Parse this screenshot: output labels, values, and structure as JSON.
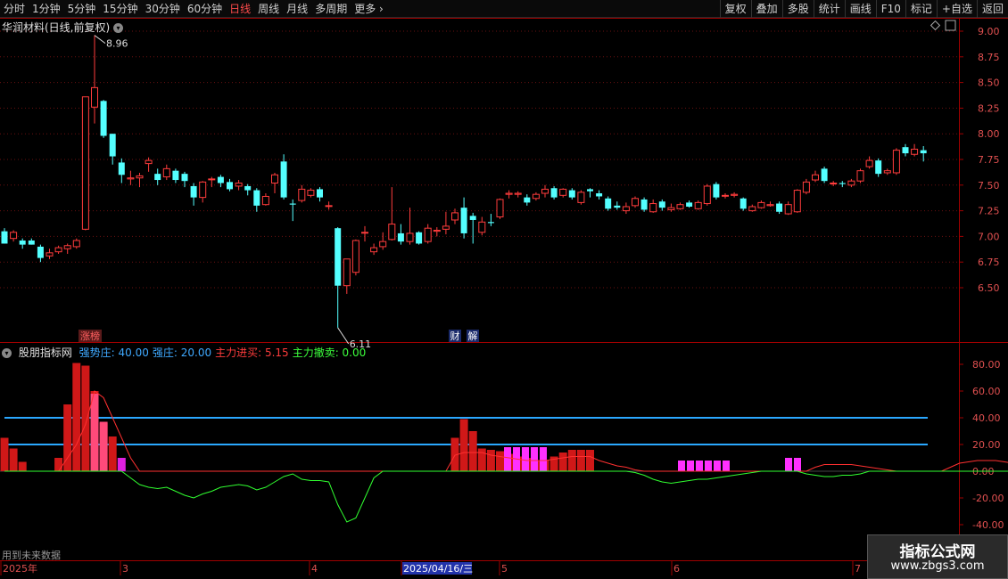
{
  "toolbar": {
    "periods": [
      "分时",
      "1分钟",
      "5分钟",
      "15分钟",
      "30分钟",
      "60分钟",
      "日线",
      "周线",
      "月线",
      "多周期",
      "更多"
    ],
    "active_period": "日线",
    "tools": [
      "复权",
      "叠加",
      "多股",
      "统计",
      "画线",
      "F10",
      "标记",
      "+自选",
      "返回"
    ]
  },
  "main_chart": {
    "title": "华润材料(日线,前复权)",
    "price_axis_ticks": [
      "9.00",
      "8.75",
      "8.50",
      "8.25",
      "8.00",
      "7.75",
      "7.50",
      "7.25",
      "7.00",
      "6.75",
      "6.50"
    ],
    "high_marker": "8.96",
    "low_marker": "6.11",
    "event_tags": [
      "涨榜",
      "财",
      "解"
    ],
    "colors": {
      "up": "#ff3c3c",
      "down": "#54ffff",
      "grid": "#7a1a1a",
      "axis": "#a00000"
    }
  },
  "indicator": {
    "name": "股朋指标网",
    "params": [
      {
        "label": "强势庄:",
        "value": "40.00",
        "color": "#3fa9ff"
      },
      {
        "label": "强庄:",
        "value": "20.00",
        "color": "#3fa9ff"
      },
      {
        "label": "主力进买:",
        "value": "5.15",
        "color": "#ff3c3c"
      },
      {
        "label": "主力撤卖:",
        "value": "0.00",
        "color": "#3cff3c"
      }
    ],
    "axis_ticks": [
      "80.00",
      "60.00",
      "40.00",
      "20.00",
      "0.00",
      "-20.00",
      "-40.00"
    ],
    "future_note": "用到未来数据"
  },
  "time_axis": {
    "labels": [
      "2025年",
      "3",
      "4",
      "2025/04/16/三",
      "5",
      "6",
      "7"
    ]
  },
  "watermark": {
    "title": "指标公式网",
    "url": "www.zbgs3.com"
  },
  "chart_data": {
    "type": "candlestick",
    "candles": [
      [
        7.05,
        6.93,
        7.08,
        6.93
      ],
      [
        6.98,
        7.04,
        7.06,
        6.95
      ],
      [
        6.96,
        6.92,
        6.98,
        6.88
      ],
      [
        6.96,
        6.92,
        6.98,
        6.92
      ],
      [
        6.9,
        6.79,
        6.92,
        6.75
      ],
      [
        6.81,
        6.84,
        6.88,
        6.78
      ],
      [
        6.85,
        6.89,
        6.91,
        6.83
      ],
      [
        6.88,
        6.91,
        6.93,
        6.83
      ],
      [
        6.9,
        6.96,
        6.98,
        6.88
      ],
      [
        7.07,
        8.36,
        8.36,
        7.06
      ],
      [
        8.26,
        8.45,
        8.96,
        8.1
      ],
      [
        8.32,
        7.98,
        8.33,
        7.96
      ],
      [
        8.0,
        7.78,
        8.0,
        7.7
      ],
      [
        7.72,
        7.6,
        7.76,
        7.52
      ],
      [
        7.56,
        7.57,
        7.64,
        7.5
      ],
      [
        7.57,
        7.59,
        7.62,
        7.48
      ],
      [
        7.71,
        7.74,
        7.77,
        7.63
      ],
      [
        7.61,
        7.55,
        7.66,
        7.5
      ],
      [
        7.58,
        7.66,
        7.7,
        7.55
      ],
      [
        7.64,
        7.55,
        7.66,
        7.52
      ],
      [
        7.61,
        7.54,
        7.63,
        7.48
      ],
      [
        7.49,
        7.38,
        7.52,
        7.3
      ],
      [
        7.38,
        7.53,
        7.54,
        7.33
      ],
      [
        7.56,
        7.56,
        7.58,
        7.48
      ],
      [
        7.58,
        7.52,
        7.6,
        7.48
      ],
      [
        7.53,
        7.46,
        7.56,
        7.44
      ],
      [
        7.49,
        7.52,
        7.55,
        7.45
      ],
      [
        7.49,
        7.45,
        7.51,
        7.4
      ],
      [
        7.45,
        7.3,
        7.47,
        7.24
      ],
      [
        7.31,
        7.39,
        7.42,
        7.3
      ],
      [
        7.52,
        7.6,
        7.62,
        7.42
      ],
      [
        7.73,
        7.38,
        7.8,
        7.36
      ],
      [
        7.32,
        7.31,
        7.36,
        7.15
      ],
      [
        7.35,
        7.46,
        7.5,
        7.33
      ],
      [
        7.4,
        7.45,
        7.47,
        7.38
      ],
      [
        7.46,
        7.38,
        7.48,
        7.34
      ],
      [
        7.3,
        7.3,
        7.34,
        7.26
      ],
      [
        7.08,
        6.52,
        7.09,
        6.11
      ],
      [
        6.52,
        6.78,
        6.78,
        6.44
      ],
      [
        6.65,
        6.96,
        6.97,
        6.62
      ],
      [
        7.04,
        7.04,
        7.1,
        6.95
      ],
      [
        6.85,
        6.89,
        6.93,
        6.82
      ],
      [
        6.9,
        6.95,
        7.04,
        6.87
      ],
      [
        6.97,
        7.12,
        7.48,
        6.96
      ],
      [
        7.03,
        6.95,
        7.12,
        6.92
      ],
      [
        6.95,
        7.03,
        7.28,
        6.92
      ],
      [
        7.04,
        6.93,
        7.05,
        6.92
      ],
      [
        6.95,
        7.08,
        7.12,
        6.93
      ],
      [
        7.05,
        7.06,
        7.09,
        7.0
      ],
      [
        7.07,
        7.1,
        7.24,
        7.02
      ],
      [
        7.16,
        7.23,
        7.27,
        7.12
      ],
      [
        7.28,
        7.03,
        7.38,
        6.98
      ],
      [
        7.2,
        7.16,
        7.23,
        6.93
      ],
      [
        7.04,
        7.14,
        7.19,
        7.01
      ],
      [
        7.14,
        7.13,
        7.22,
        7.1
      ],
      [
        7.19,
        7.36,
        7.37,
        7.17
      ],
      [
        7.41,
        7.42,
        7.45,
        7.37
      ],
      [
        7.41,
        7.42,
        7.44,
        7.38
      ],
      [
        7.38,
        7.33,
        7.41,
        7.3
      ],
      [
        7.37,
        7.41,
        7.43,
        7.35
      ],
      [
        7.42,
        7.46,
        7.5,
        7.38
      ],
      [
        7.47,
        7.38,
        7.49,
        7.36
      ],
      [
        7.4,
        7.46,
        7.47,
        7.38
      ],
      [
        7.45,
        7.38,
        7.47,
        7.36
      ],
      [
        7.33,
        7.43,
        7.45,
        7.31
      ],
      [
        7.46,
        7.44,
        7.47,
        7.38
      ],
      [
        7.42,
        7.39,
        7.45,
        7.36
      ],
      [
        7.37,
        7.27,
        7.39,
        7.25
      ],
      [
        7.3,
        7.28,
        7.34,
        7.26
      ],
      [
        7.25,
        7.29,
        7.33,
        7.22
      ],
      [
        7.3,
        7.37,
        7.39,
        7.28
      ],
      [
        7.36,
        7.26,
        7.38,
        7.24
      ],
      [
        7.24,
        7.32,
        7.36,
        7.23
      ],
      [
        7.34,
        7.28,
        7.36,
        7.25
      ],
      [
        7.26,
        7.28,
        7.32,
        7.24
      ],
      [
        7.27,
        7.31,
        7.33,
        7.26
      ],
      [
        7.33,
        7.29,
        7.35,
        7.28
      ],
      [
        7.27,
        7.33,
        7.35,
        7.26
      ],
      [
        7.32,
        7.49,
        7.51,
        7.3
      ],
      [
        7.51,
        7.38,
        7.53,
        7.36
      ],
      [
        7.4,
        7.4,
        7.42,
        7.37
      ],
      [
        7.4,
        7.41,
        7.43,
        7.38
      ],
      [
        7.37,
        7.27,
        7.38,
        7.25
      ],
      [
        7.25,
        7.29,
        7.31,
        7.24
      ],
      [
        7.28,
        7.33,
        7.35,
        7.27
      ],
      [
        7.3,
        7.31,
        7.34,
        7.29
      ],
      [
        7.32,
        7.24,
        7.34,
        7.22
      ],
      [
        7.22,
        7.31,
        7.34,
        7.21
      ],
      [
        7.24,
        7.45,
        7.46,
        7.23
      ],
      [
        7.43,
        7.53,
        7.56,
        7.41
      ],
      [
        7.55,
        7.6,
        7.64,
        7.53
      ],
      [
        7.66,
        7.54,
        7.68,
        7.52
      ],
      [
        7.52,
        7.52,
        7.54,
        7.49
      ],
      [
        7.52,
        7.51,
        7.54,
        7.48
      ],
      [
        7.5,
        7.54,
        7.56,
        7.48
      ],
      [
        7.54,
        7.64,
        7.66,
        7.52
      ],
      [
        7.68,
        7.74,
        7.78,
        7.66
      ],
      [
        7.74,
        7.61,
        7.76,
        7.58
      ],
      [
        7.62,
        7.64,
        7.66,
        7.6
      ],
      [
        7.62,
        7.84,
        7.86,
        7.6
      ],
      [
        7.87,
        7.81,
        7.9,
        7.78
      ],
      [
        7.8,
        7.85,
        7.9,
        7.78
      ],
      [
        7.84,
        7.81,
        7.88,
        7.73
      ]
    ],
    "indicator_bars": {
      "red": [
        25,
        17,
        7,
        0,
        0,
        0,
        10,
        50,
        81,
        79,
        60,
        36,
        26,
        0,
        0,
        0,
        0,
        0,
        0,
        0,
        0,
        0,
        0,
        0,
        0,
        0,
        0,
        0,
        0,
        0,
        0,
        0,
        0,
        0,
        0,
        0,
        0,
        0,
        0,
        0,
        0,
        0,
        0,
        0,
        0,
        0,
        0,
        0,
        0,
        0,
        25,
        39,
        30,
        17,
        16,
        15,
        13,
        11,
        10,
        8,
        8,
        11,
        14,
        16,
        16,
        16,
        0,
        0,
        0,
        0,
        0,
        0,
        0,
        0,
        0,
        0,
        0,
        0,
        0,
        0,
        0,
        0,
        0,
        0,
        0,
        0,
        0,
        0,
        0,
        0,
        0,
        0,
        0,
        0,
        0,
        0,
        0,
        0,
        0,
        0,
        0,
        0,
        0,
        0,
        0,
        0,
        0,
        0,
        0,
        0,
        0,
        0,
        0,
        0,
        0,
        0,
        0,
        0,
        0,
        0,
        0,
        0,
        0,
        0,
        0,
        0
      ],
      "pink": [
        0,
        0,
        0,
        0,
        0,
        0,
        0,
        0,
        0,
        0,
        58,
        37,
        0,
        0,
        0,
        0,
        0,
        0,
        0,
        0,
        0,
        0,
        0,
        0,
        0,
        0,
        0,
        0,
        0,
        0,
        0,
        0,
        0,
        0,
        0,
        0,
        0,
        0,
        0,
        0,
        0,
        0,
        0,
        0,
        0,
        0,
        0,
        0,
        0,
        0,
        0,
        0,
        0,
        0,
        0,
        0,
        0,
        0,
        0,
        0,
        0,
        0,
        0,
        0,
        0,
        0,
        0,
        0,
        0,
        0,
        0,
        0,
        0,
        0,
        0,
        0,
        0,
        0,
        0,
        0,
        0,
        0,
        0,
        0,
        0,
        0,
        0,
        0,
        0,
        0,
        0,
        0,
        0,
        0,
        0,
        0,
        0,
        0,
        0,
        0,
        0,
        0,
        0,
        0,
        0,
        0,
        0,
        0,
        0,
        0,
        0,
        0,
        0,
        0,
        0,
        0,
        0,
        0,
        0,
        0,
        0,
        0,
        0,
        0,
        0,
        0,
        0
      ],
      "magenta": [
        0,
        0,
        0,
        0,
        0,
        0,
        0,
        0,
        0,
        0,
        0,
        0,
        0,
        10,
        0,
        0,
        0,
        0,
        0,
        0,
        0,
        0,
        0,
        0,
        0,
        0,
        0,
        0,
        0,
        0,
        0,
        0,
        0,
        0,
        0,
        0,
        0,
        0,
        0,
        0,
        0,
        0,
        0,
        0,
        0,
        0,
        0,
        0,
        0,
        0,
        0,
        0,
        0,
        0,
        0,
        0,
        0,
        0,
        0,
        0,
        0,
        0,
        0,
        0,
        0,
        0,
        0,
        0,
        0,
        0,
        0,
        0,
        0,
        0,
        0,
        0,
        0,
        0,
        0,
        0,
        0,
        0,
        0,
        0,
        0,
        0,
        0,
        0,
        0,
        0,
        0,
        0,
        0,
        0,
        0,
        0,
        0,
        0,
        0,
        0,
        0,
        0,
        0,
        0,
        0,
        0,
        0,
        0,
        0,
        0,
        0,
        0,
        0,
        0,
        0,
        0,
        0,
        0,
        0,
        0,
        0,
        0,
        0,
        0,
        0,
        0,
        0
      ]
    },
    "indicator_series": {
      "red_line": [
        0,
        0,
        0,
        0,
        0,
        0,
        0,
        10,
        20,
        35,
        60,
        55,
        40,
        25,
        10,
        0,
        0,
        0,
        0,
        0,
        0,
        0,
        0,
        0,
        0,
        0,
        0,
        0,
        0,
        0,
        0,
        0,
        0,
        0,
        0,
        0,
        0,
        0,
        0,
        0,
        0,
        0,
        0,
        0,
        0,
        0,
        0,
        0,
        0,
        0,
        12,
        14,
        14,
        14,
        12,
        11,
        10,
        9,
        8,
        8,
        8,
        9,
        10,
        11,
        11,
        11,
        8,
        6,
        4,
        3,
        1,
        0,
        0,
        0,
        0,
        0,
        0,
        0,
        0,
        0,
        0,
        0,
        0,
        0,
        0,
        0,
        0,
        0,
        0,
        0,
        3,
        5,
        5,
        5,
        5,
        4,
        3,
        2,
        1,
        0,
        0,
        0,
        0,
        0,
        0,
        3,
        6,
        7,
        8,
        8,
        8,
        7,
        6,
        5,
        4,
        3,
        3,
        3,
        4,
        6,
        7,
        8,
        8,
        9,
        10
      ],
      "green_line": [
        0,
        0,
        0,
        0,
        0,
        0,
        0,
        0,
        0,
        0,
        0,
        0,
        0,
        0,
        -5,
        -10,
        -12,
        -13,
        -12,
        -15,
        -18,
        -20,
        -17,
        -15,
        -12,
        -11,
        -10,
        -11,
        -14,
        -12,
        -8,
        -4,
        -2,
        -6,
        -7,
        -7,
        -8,
        -25,
        -38,
        -35,
        -20,
        -5,
        0,
        0,
        0,
        0,
        0,
        0,
        0,
        0,
        0,
        0,
        0,
        0,
        0,
        0,
        0,
        0,
        0,
        0,
        0,
        0,
        0,
        0,
        0,
        0,
        0,
        0,
        0,
        0,
        -1,
        -3,
        -6,
        -8,
        -9,
        -8,
        -7,
        -6,
        -6,
        -5,
        -4,
        -3,
        -2,
        -1,
        0,
        0,
        0,
        0,
        0,
        -2,
        -3,
        -4,
        -4,
        -3,
        -3,
        -2,
        0,
        0,
        0,
        0,
        0,
        0,
        0,
        0,
        0,
        0,
        0,
        0,
        0,
        0,
        0,
        0,
        0,
        0,
        0,
        0,
        0,
        0,
        0,
        0,
        0
      ]
    },
    "reference_lines": [
      40,
      20
    ],
    "y_range_price": [
      6.11,
      8.96
    ],
    "y_range_indicator": [
      -40,
      80
    ]
  }
}
